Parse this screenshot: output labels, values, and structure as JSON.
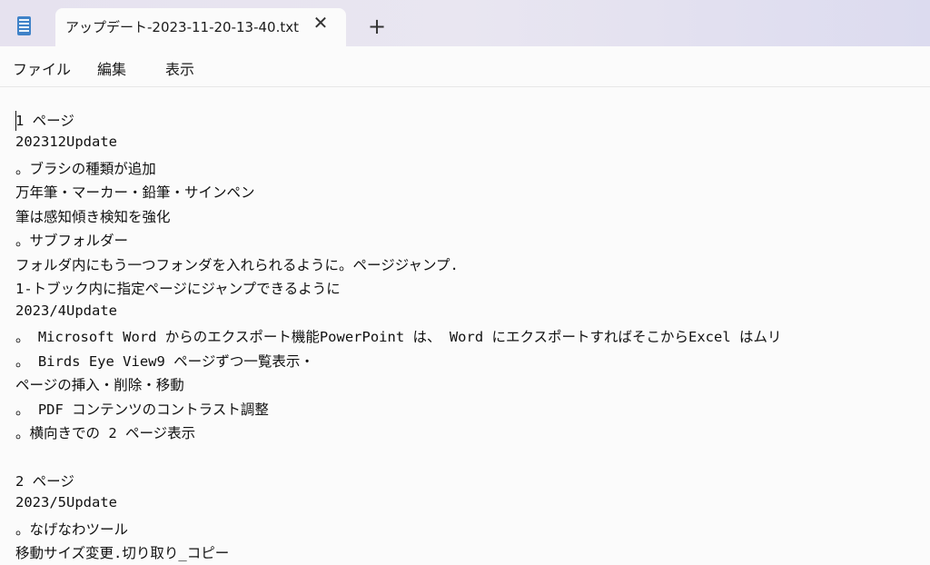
{
  "tab": {
    "title": "アップデート-2023-11-20-13-40.txt",
    "close_label": "✕",
    "new_tab_label": "+"
  },
  "menu": {
    "items": [
      "ファイル",
      "編集",
      "表示"
    ]
  },
  "editor": {
    "lines": [
      "1 ページ",
      "202312Update",
      "。ブラシの種類が追加",
      "万年筆・マーカー・鉛筆・サインペン",
      "筆は感知傾き検知を強化",
      "。サブフォルダー",
      "フォルダ内にもう一つフォンダを入れられるように。ページジャンプ.",
      "1-トブック内に指定ページにジャンプできるように",
      "2023/4Update",
      "。 Microsoft Word からのエクスポート機能PowerPoint は、 Word にエクスポートすればそこからExcel はムリ",
      "。 Birds Eye View9 ページずつ一覧表示・",
      "ページの挿入・削除・移動",
      "。 PDF コンテンツのコントラスト調整",
      "。横向きでの 2 ページ表示",
      "",
      "2 ページ",
      "2023/5Update",
      "。なげなわツール",
      "移動サイズ変更.切り取り_コピー"
    ]
  }
}
